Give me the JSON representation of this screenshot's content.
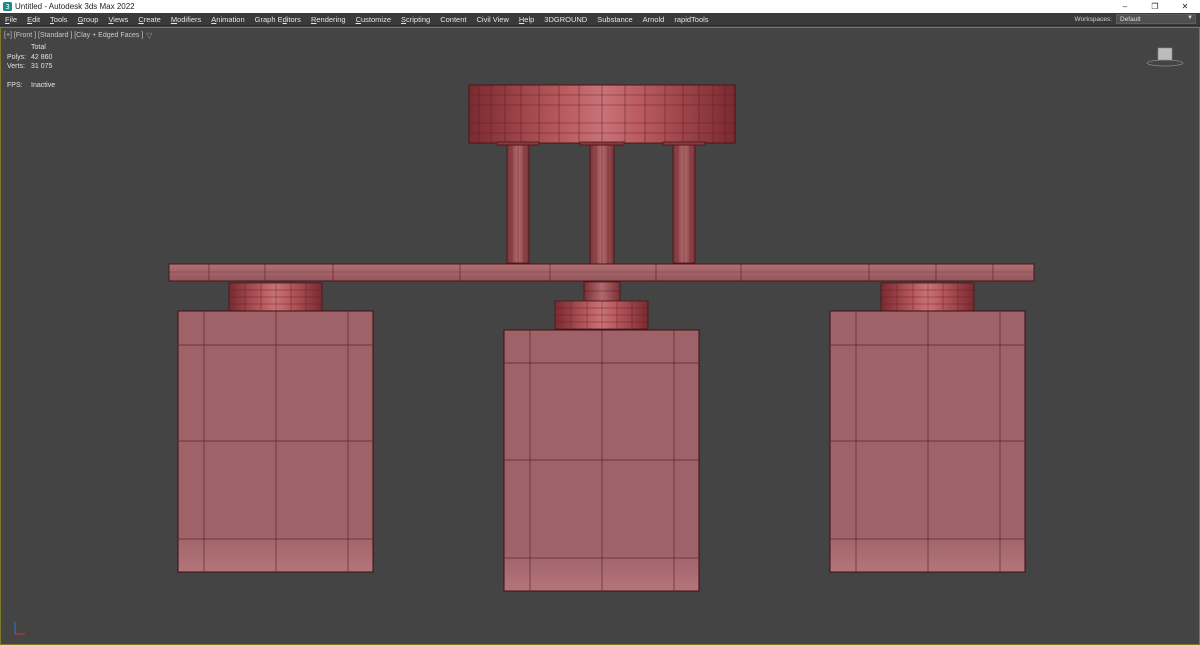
{
  "window": {
    "title": "Untitled - Autodesk 3ds Max 2022",
    "controls": {
      "minimize": "–",
      "restore": "❐",
      "close": "✕"
    }
  },
  "menu": {
    "items": [
      {
        "label": "File",
        "u": "F",
        "rest": "ile"
      },
      {
        "label": "Edit",
        "u": "E",
        "rest": "dit"
      },
      {
        "label": "Tools",
        "u": "T",
        "rest": "ools"
      },
      {
        "label": "Group",
        "u": "G",
        "rest": "roup"
      },
      {
        "label": "Views",
        "u": "V",
        "rest": "iews"
      },
      {
        "label": "Create",
        "u": "C",
        "rest": "reate"
      },
      {
        "label": "Modifiers",
        "u": "M",
        "rest": "odifiers"
      },
      {
        "label": "Animation",
        "u": "A",
        "rest": "nimation"
      },
      {
        "label": "Graph Editors",
        "pre": "Graph E",
        "u": "d",
        "rest": "itors"
      },
      {
        "label": "Rendering",
        "u": "R",
        "rest": "endering"
      },
      {
        "label": "Customize",
        "u": "C",
        "rest": "ustomize"
      },
      {
        "label": "Scripting",
        "u": "S",
        "rest": "cripting"
      },
      {
        "label": "Content",
        "u": "",
        "rest": "Content"
      },
      {
        "label": "Civil View",
        "u": "",
        "rest": "Civil View"
      },
      {
        "label": "Help",
        "u": "H",
        "rest": "elp"
      },
      {
        "label": "3DGROUND",
        "u": "",
        "rest": "3DGROUND"
      },
      {
        "label": "Substance",
        "u": "",
        "rest": "Substance"
      },
      {
        "label": "Arnold",
        "u": "",
        "rest": "Arnold"
      },
      {
        "label": "rapidTools",
        "u": "",
        "rest": "rapidTools"
      }
    ],
    "workspace_label": "Workspaces:",
    "workspace_value": "Default"
  },
  "viewport": {
    "label": "[+] [Front ] [Standard ] [Clay + Edged Faces ]",
    "stats": {
      "header": "Total",
      "polys_label": "Polys:",
      "polys": "42 860",
      "verts_label": "Verts:",
      "verts": "31 075",
      "fps_label": "FPS:",
      "fps": "Inactive"
    }
  },
  "colors": {
    "clay": "#9b6168",
    "clay_light": "#b87a80",
    "wire": "#5a1d22",
    "dark_red": "#8a2e33",
    "background": "#444444"
  },
  "icons": [
    "app-icon",
    "viewcube-icon",
    "axis-tripod-icon",
    "viewport-filter-icon"
  ]
}
